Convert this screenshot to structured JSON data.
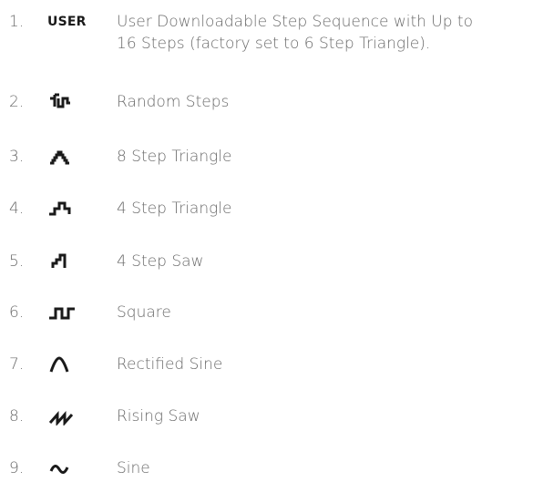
{
  "items": [
    {
      "number": "1.",
      "icon": "user-badge",
      "icon_text": "USER",
      "line1": "User Downloadable Step Sequence with Up to",
      "line2": "16 Steps (factory set to 6 Step Triangle)."
    },
    {
      "number": "2.",
      "icon": "random-steps-icon",
      "line1": "Random Steps"
    },
    {
      "number": "3.",
      "icon": "eight-step-triangle-icon",
      "line1": "8 Step Triangle"
    },
    {
      "number": "4.",
      "icon": "four-step-triangle-icon",
      "line1": "4 Step Triangle"
    },
    {
      "number": "5.",
      "icon": "four-step-saw-icon",
      "line1": "4 Step Saw"
    },
    {
      "number": "6.",
      "icon": "square-wave-icon",
      "line1": "Square"
    },
    {
      "number": "7.",
      "icon": "rectified-sine-icon",
      "line1": "Rectified Sine"
    },
    {
      "number": "8.",
      "icon": "rising-saw-icon",
      "line1": "Rising Saw"
    },
    {
      "number": "9.",
      "icon": "sine-wave-icon",
      "line1": "Sine"
    }
  ],
  "colors": {
    "text": "#6a6a6a",
    "icon": "#1a1a1a"
  }
}
